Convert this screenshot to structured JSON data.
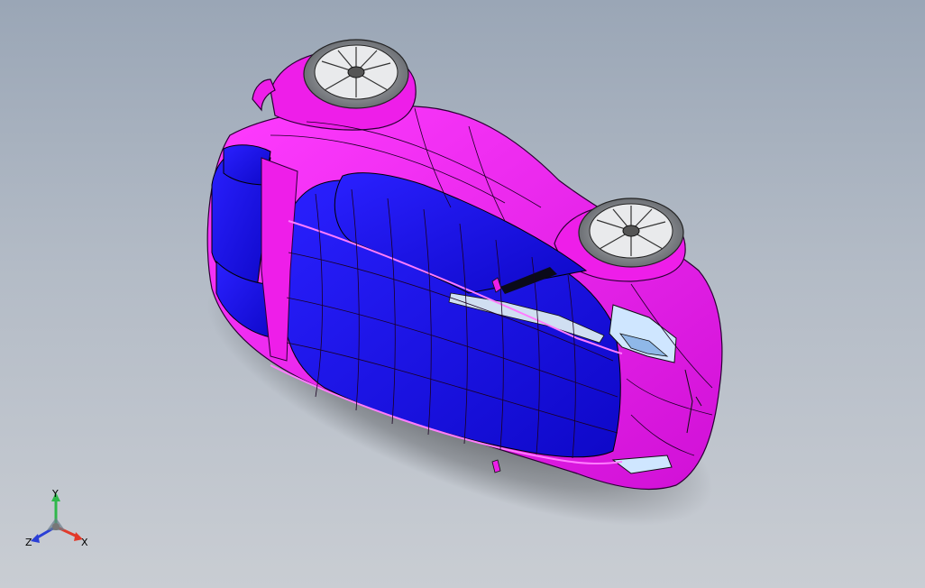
{
  "viewport": {
    "background_top": "#9aa6b6",
    "background_bottom": "#c9cdd3"
  },
  "model": {
    "icon": "car-body-model",
    "colors": {
      "body_magenta": "#ee1ee9",
      "panel_blue": "#1a10f0",
      "edge_lines": "#2a0033",
      "wheel_gray": "#8a8d92",
      "glass_light": "#cfe6ff"
    }
  },
  "triad": {
    "x_label": "X",
    "y_label": "Y",
    "z_label": "Z",
    "x_color": "#e23a2a",
    "y_color": "#2fb84a",
    "z_color": "#2a3fd6"
  }
}
